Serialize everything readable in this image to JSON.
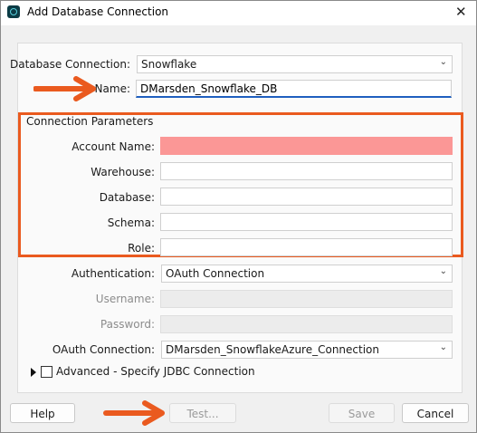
{
  "window": {
    "title": "Add Database Connection"
  },
  "form": {
    "database_connection": {
      "label": "Database Connection:",
      "value": "Snowflake"
    },
    "name": {
      "label": "Name:",
      "value": "DMarsden_Snowflake_DB"
    }
  },
  "connection_parameters": {
    "title": "Connection Parameters",
    "account_name": {
      "label": "Account Name:",
      "value": ""
    },
    "warehouse": {
      "label": "Warehouse:",
      "value": ""
    },
    "database": {
      "label": "Database:",
      "value": ""
    },
    "schema": {
      "label": "Schema:",
      "value": ""
    },
    "role": {
      "label": "Role:",
      "value": ""
    }
  },
  "auth": {
    "authentication": {
      "label": "Authentication:",
      "value": "OAuth Connection"
    },
    "username": {
      "label": "Username:",
      "value": ""
    },
    "password": {
      "label": "Password:",
      "value": ""
    },
    "oauth_connection": {
      "label": "OAuth Connection:",
      "value": "DMarsden_SnowflakeAzure_Connection"
    }
  },
  "advanced": {
    "label": "Advanced - Specify JDBC Connection",
    "checked": false
  },
  "buttons": {
    "help": "Help",
    "test": "Test...",
    "save": "Save",
    "cancel": "Cancel"
  },
  "colors": {
    "highlight_orange": "#ea5a1f",
    "required_pink": "#fb9796",
    "focus_blue": "#1f5fbf"
  }
}
